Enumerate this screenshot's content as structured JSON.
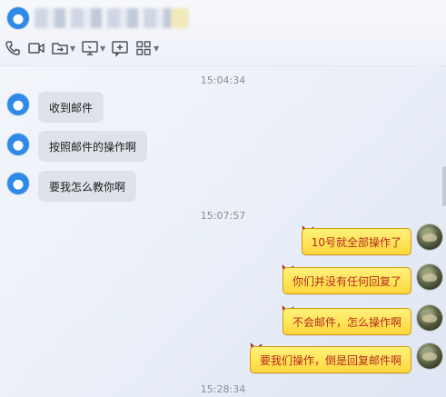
{
  "header": {
    "toolbar": [
      {
        "icon": "phone-icon"
      },
      {
        "icon": "video-camera-icon"
      },
      {
        "icon": "share-folder-icon",
        "dropdown": true
      },
      {
        "icon": "screen-share-icon",
        "dropdown": true
      },
      {
        "icon": "add-chat-icon"
      },
      {
        "icon": "apps-grid-icon",
        "dropdown": true
      }
    ]
  },
  "messages": {
    "timestamp_1": "15:04:34",
    "timestamp_2": "15:07:57",
    "timestamp_3": "15:28:34",
    "incoming": [
      {
        "text": "收到邮件"
      },
      {
        "text": "按照邮件的操作啊"
      },
      {
        "text": "要我怎么教你啊"
      }
    ],
    "outgoing": [
      {
        "text": "10号就全部操作了"
      },
      {
        "text": "你们并没有任何回复了"
      },
      {
        "text": "不会邮件，怎么操作啊"
      },
      {
        "text": "要我们操作，倒是回复邮件啊"
      }
    ]
  },
  "colors": {
    "bubble_out_fill": "#ffe35a",
    "bubble_out_border": "#d49a11",
    "bubble_out_text": "#b5291d",
    "bubble_in_fill": "#dfe2ea",
    "qq_blue": "#2e8ae6"
  }
}
